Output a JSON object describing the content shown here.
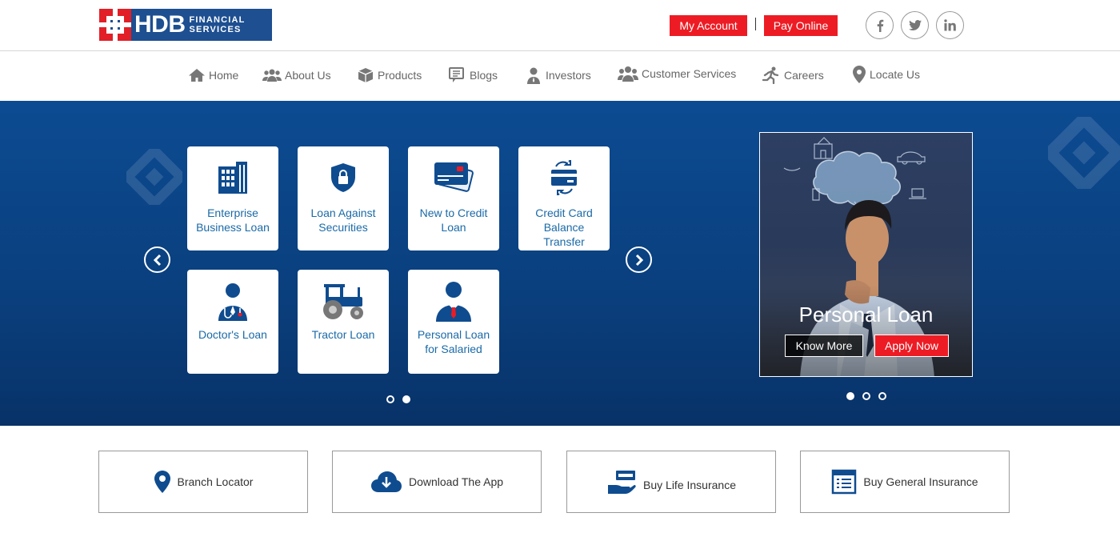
{
  "header": {
    "logo": {
      "main": "HDB",
      "line1": "FINANCIAL",
      "line2": "SERVICES"
    },
    "my_account": "My Account",
    "pay_online": "Pay Online",
    "social": {
      "facebook": "f",
      "twitter": "twitter-icon",
      "linkedin": "in"
    }
  },
  "nav": {
    "items": [
      {
        "label": "Home",
        "icon": "home-icon"
      },
      {
        "label": "About Us",
        "icon": "group-icon"
      },
      {
        "label": "Products",
        "icon": "cube-icon"
      },
      {
        "label": "Blogs",
        "icon": "chat-icon"
      },
      {
        "label": "Investors",
        "icon": "person-icon"
      },
      {
        "label": "Customer Services",
        "icon": "users-icon"
      },
      {
        "label": "Careers",
        "icon": "runner-icon"
      },
      {
        "label": "Locate Us",
        "icon": "map-pin-icon"
      }
    ]
  },
  "products": [
    {
      "label": "Enterprise Business Loan",
      "icon": "building-icon"
    },
    {
      "label": "Loan Against Securities",
      "icon": "shield-lock-icon"
    },
    {
      "label": "New to Credit Loan",
      "icon": "credit-cards-icon"
    },
    {
      "label": "Credit Card Balance Transfer",
      "icon": "card-transfer-icon"
    },
    {
      "label": "Doctor's Loan",
      "icon": "doctor-icon"
    },
    {
      "label": "Tractor Loan",
      "icon": "tractor-icon"
    },
    {
      "label": "Personal Loan for Salaried",
      "icon": "businessman-icon"
    }
  ],
  "carousel": {
    "pages": 2,
    "active": 2
  },
  "promo": {
    "title": "Personal Loan",
    "know_more": "Know More",
    "apply_now": "Apply Now",
    "slides": 3,
    "active": 1
  },
  "quick_links": [
    {
      "label": "Branch Locator",
      "icon": "map-pin-icon"
    },
    {
      "label": "Download The App",
      "icon": "cloud-download-icon"
    },
    {
      "label": "Buy Life Insurance",
      "icon": "hand-insurance-icon"
    },
    {
      "label": "Buy General Insurance",
      "icon": "document-list-icon"
    }
  ],
  "colors": {
    "brand_blue": "#1d4f91",
    "brand_red": "#ed1c24",
    "tile_text": "#1a6aa8"
  }
}
